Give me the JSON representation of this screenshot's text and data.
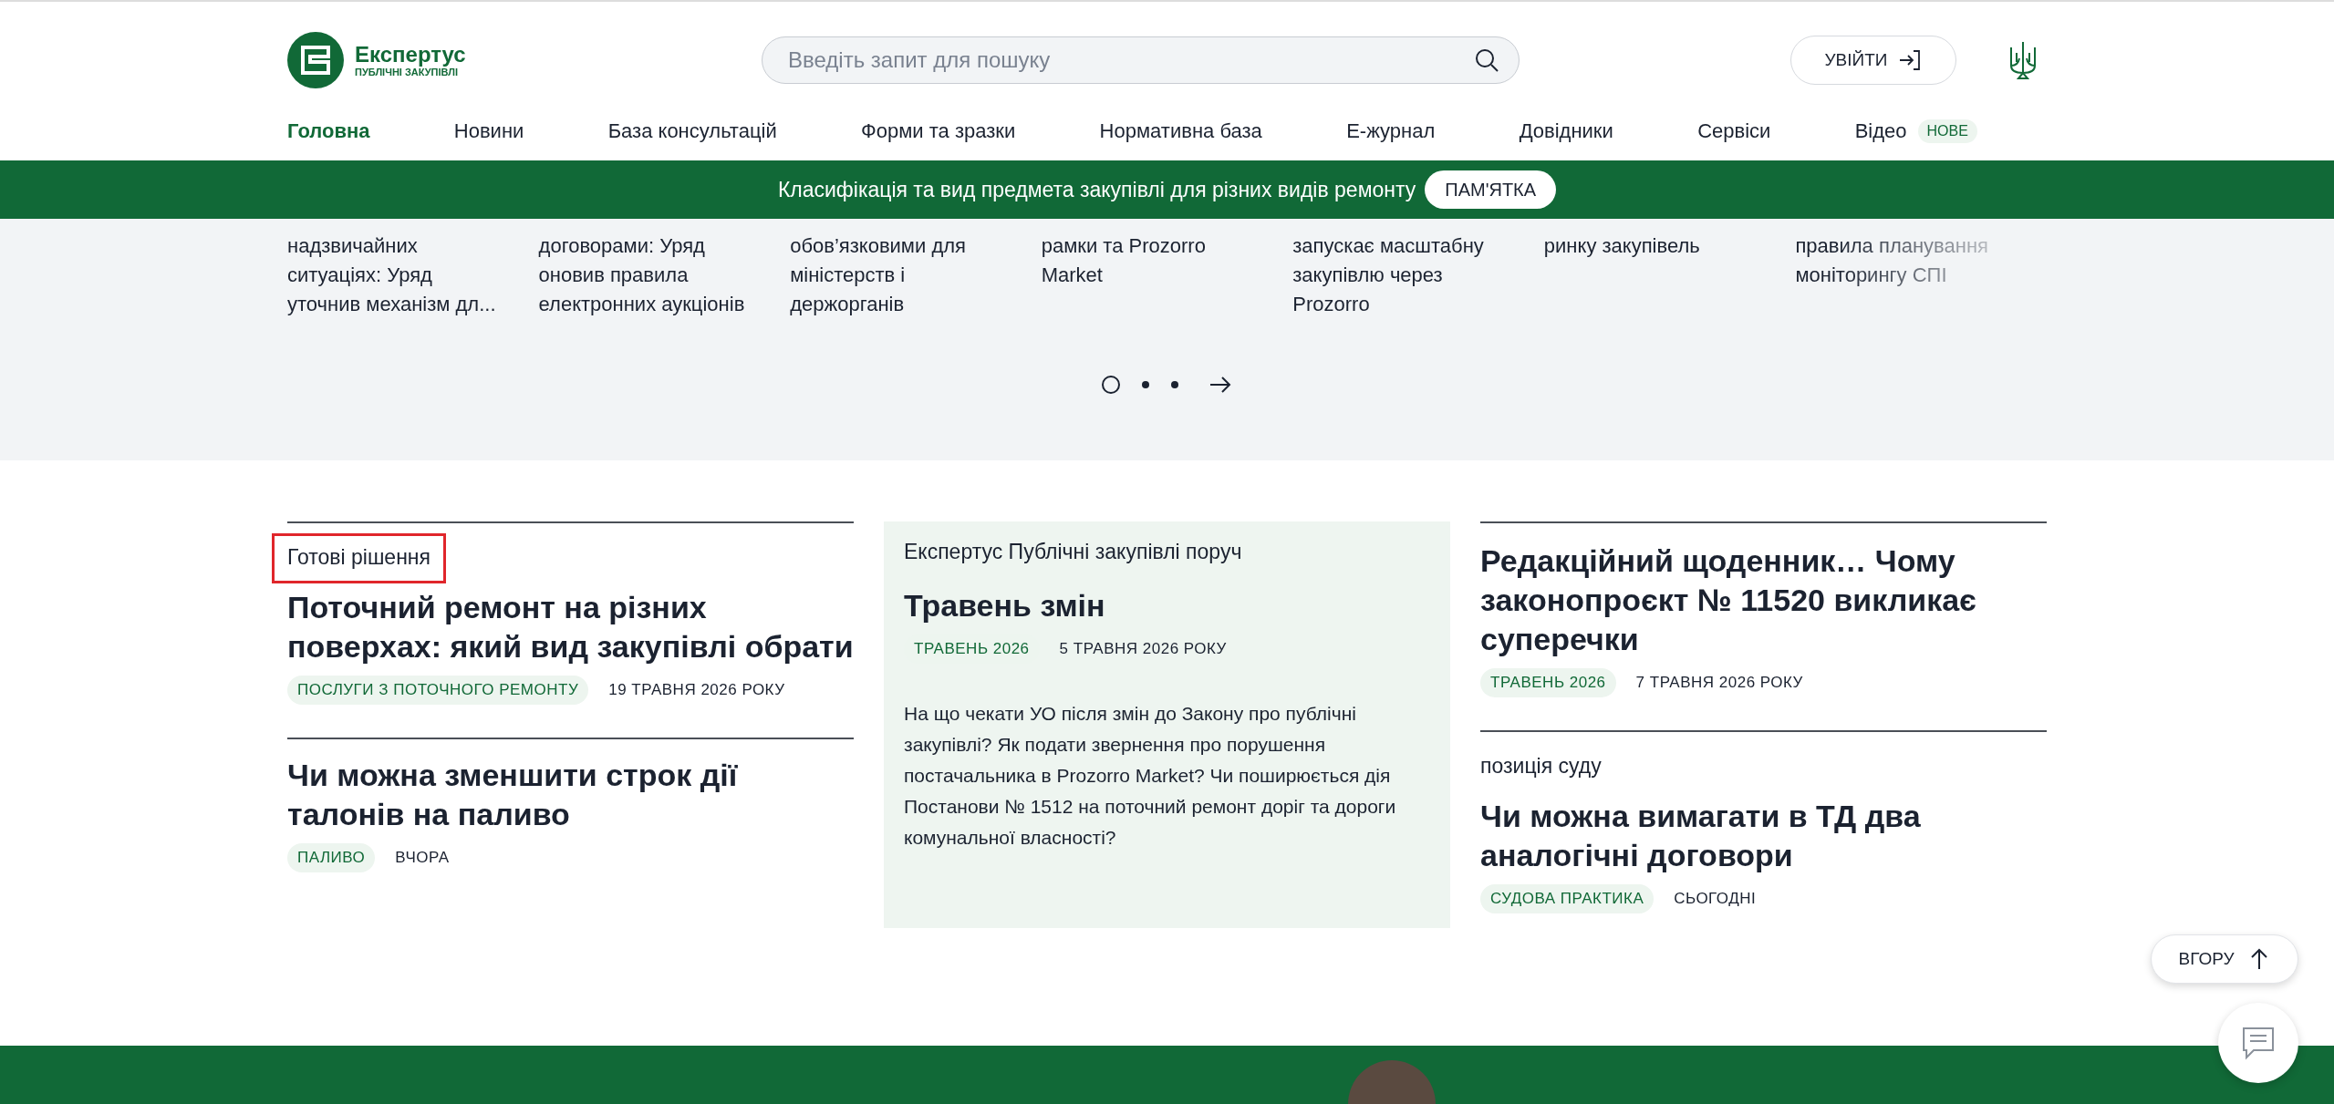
{
  "header": {
    "logo": {
      "name": "Експертус",
      "subtitle": "ПУБЛІЧНІ ЗАКУПІВЛІ"
    },
    "search": {
      "placeholder": "Введіть запит для пошуку"
    },
    "login_button": "УВІЙТИ"
  },
  "nav": [
    {
      "label": "Головна",
      "selected": true
    },
    {
      "label": "Новини",
      "selected": false
    },
    {
      "label": "База консультацій",
      "selected": false
    },
    {
      "label": "Форми та зразки",
      "selected": false
    },
    {
      "label": "Нормативна база",
      "selected": false
    },
    {
      "label": "Е-журнал",
      "selected": false
    },
    {
      "label": "Довідники",
      "selected": false
    },
    {
      "label": "Сервіси",
      "selected": false
    },
    {
      "label": "Відео",
      "selected": false,
      "badge": "НОВЕ"
    }
  ],
  "banner": {
    "text": "Класифікація та вид предмета закупівлі для різних видів ремонту",
    "button": "ПАМ'ЯТКА"
  },
  "news_strip": {
    "items": [
      "надзвичайних ситуаціях: Уряд уточнив механізм дл...",
      "договорами: Уряд оновив правила електронних аукціонів",
      "обов’язковими для міністерств і держорганів",
      "рамки та Prozorro Market",
      "запускає масштабну закупівлю через Prozorro",
      "ринку закупівель",
      "правила планування моніторингу СПІ"
    ],
    "pager": [
      {
        "selected": true
      },
      {
        "selected": false
      },
      {
        "selected": false
      }
    ]
  },
  "left_column": {
    "section": {
      "label": "Готові рішення",
      "highlighted": true
    },
    "articles": [
      {
        "title": "Поточний ремонт на різних поверхах: який вид закупівлі обрати",
        "tag": "ПОСЛУГИ З ПОТОЧНОГО РЕМОНТУ",
        "date": "19 ТРАВНЯ 2026 РОКУ"
      },
      {
        "title": "Чи можна зменшити строк дії талонів на паливо",
        "tag": "ПАЛИВО",
        "date": "ВЧОРА"
      }
    ]
  },
  "middle_column": {
    "label": "Експертус Публічні закупівлі поруч",
    "title": "Травень змін",
    "tag": "ТРАВЕНЬ 2026",
    "date": "5 ТРАВНЯ 2026 РОКУ",
    "text": "На що чекати УО після змін до Закону про публічні закупівлі? Як подати звернення про порушення постачальника в Prozorro Market? Чи поширюється дія Постанови № 1512 на поточний ремонт доріг та дороги комунальної власності?"
  },
  "right_column": {
    "articles": [
      {
        "title": "Редакційний щоденник… Чому законопроєкт № 11520 викликає суперечки",
        "tag": "ТРАВЕНЬ 2026",
        "date": "7 ТРАВНЯ 2026 РОКУ"
      },
      {
        "category": "позиція суду",
        "title": "Чи можна вимагати в ТД два аналогічні договори",
        "tag": "СУДОВА ПРАКТИКА",
        "date": "СЬОГОДНІ"
      }
    ]
  },
  "back_to_top": "ВГОРУ"
}
